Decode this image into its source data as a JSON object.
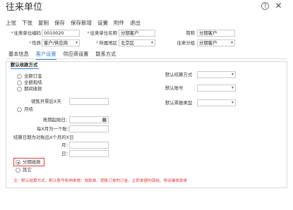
{
  "window": {
    "title": "往来单位"
  },
  "toolbar": {
    "items": [
      "上张",
      "下张",
      "复制",
      "保存",
      "保存新增",
      "设置",
      "附件",
      "退出"
    ]
  },
  "form": {
    "code_label": "往来单位编码",
    "code_value": "0010020",
    "name_label": "往来单位名称",
    "name_value": "分期客户",
    "short_label": "简称",
    "short_value": "分期客户",
    "type_label": "性质",
    "type_value": "客户/供应商",
    "region_label": "所属地区",
    "region_value": "北京区",
    "group_label": "往来分组",
    "group_value": "分期客户"
  },
  "tabs": [
    "基本信息",
    "客户设置",
    "供应商设置",
    "联系方式"
  ],
  "active_tab": 1,
  "settle": {
    "section_title": "默认收款方式",
    "opt_order": "全额订金",
    "opt_full": "全额现结",
    "opt_period": "期间收款",
    "monthly_label": "月结",
    "sales_label": "销售开票后X天",
    "acct_start_label": "账期起始日",
    "every_month_label": "每X月为一个账",
    "settle_date_label": "结算日期为对账后X个月的X日",
    "month_label": "月",
    "day_label": "日",
    "opt_install": "分期收款",
    "opt_other": "其它",
    "calendar_icon": "calendar-icon"
  },
  "right": {
    "settle_method_label": "默认结算方式",
    "account_label": "默认账号",
    "ticket_label": "默认票据类型"
  },
  "note": "注：默认结算方式、默认账号影响单据：收款单、销售订单的订金、立即单据的现结、移动端收款单",
  "colors": {
    "accent": "#3a7bd5",
    "highlight": "#e23a3a"
  }
}
